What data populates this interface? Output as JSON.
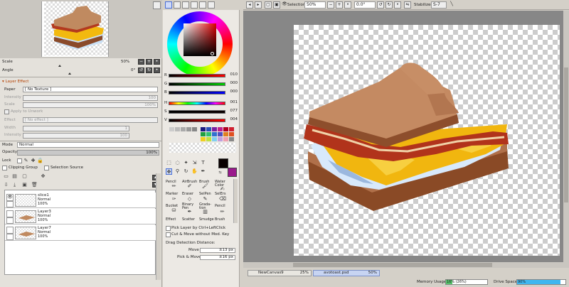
{
  "navigator": {
    "scale_label": "Scale",
    "scale_value": "50%",
    "angle_label": "Angle",
    "angle_value": "0°"
  },
  "layer_effect": {
    "header": "Layer Effect",
    "paper_label": "Paper",
    "paper_value": "[ No Texture ]",
    "intensity_label": "Intensity",
    "intensity_value": "100",
    "scale_label": "Scale",
    "scale_value": "100%",
    "apply_to_unwork": "Apply to Unwork",
    "effect_label": "Effect",
    "effect_value": "[ No effect ]",
    "width_label": "Width",
    "width_value": "1",
    "intensity2_label": "Intensity",
    "intensity2_value": "100"
  },
  "layer_props": {
    "mode_label": "Mode",
    "mode_value": "Normal",
    "opacity_label": "Opacity",
    "opacity_value": "100%",
    "lock_label": "Lock",
    "clipping_group": "Clipping Group",
    "selection_source": "Selection Source"
  },
  "layers": [
    {
      "name": "slice1",
      "mode": "Normal",
      "opacity": "100%"
    },
    {
      "name": "Layer3",
      "mode": "Normal",
      "opacity": "100%"
    },
    {
      "name": "Layer7",
      "mode": "Normal",
      "opacity": "100%"
    }
  ],
  "color": {
    "r_label": "R",
    "r_value": "010",
    "g_label": "G",
    "g_value": "000",
    "b_label": "B",
    "b_value": "000",
    "h_label": "H",
    "h_value": "001",
    "s_label": "S",
    "s_value": "077",
    "v_label": "V",
    "v_value": "004",
    "primary": "#0a0000",
    "secondary": "#9a1a8c"
  },
  "tools": {
    "brushes": [
      "Pencil",
      "AirBrush",
      "Brush",
      "Water Color",
      "Marker",
      "Eraser",
      "SelPen",
      "SelErs",
      "Bucket",
      "Binary Pen",
      "Grada-tion",
      "Pencil",
      "Effect",
      "Scatter",
      "Smudge",
      "Brush"
    ],
    "pick_layer": "Pick Layer by Ctrl+LeftClick",
    "cut_move": "Cut & Move without Mod. Key",
    "drag_title": "Drag Detection Distance:",
    "move_label": "Move",
    "move_value": "±13 px",
    "pick_move_label": "Pick & Move",
    "pick_move_value": "±16 px"
  },
  "toolbar": {
    "selection_label": "Selection",
    "zoom_value": "50%",
    "angle_value": "0.0°",
    "stabilizer_label": "Stabilizer",
    "stabilizer_value": "S-7"
  },
  "status": {
    "file1_name": "NewCanvas9",
    "file1_zoom": "25%",
    "file2_name": "avotoast.psd",
    "file2_zoom": "50%",
    "memory_label": "Memory Usage",
    "memory_value": "16% (26%)",
    "memory_fraction": 0.16,
    "drive_label": "Drive Space",
    "drive_value": "90%",
    "drive_fraction": 0.9
  }
}
